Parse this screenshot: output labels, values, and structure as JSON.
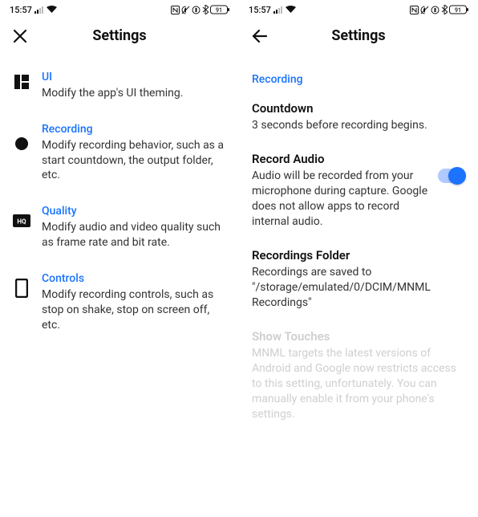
{
  "status": {
    "time": "15:57",
    "battery": "91"
  },
  "left": {
    "title": "Settings",
    "items": [
      {
        "title": "UI",
        "desc": "Modify the app's UI theming."
      },
      {
        "title": "Recording",
        "desc": "Modify recording behavior, such as a start countdown, the output folder, etc."
      },
      {
        "title": "Quality",
        "desc": "Modify audio and video quality such as frame rate and bit rate."
      },
      {
        "title": "Controls",
        "desc": "Modify recording controls, such as stop on shake, stop on screen off, etc."
      }
    ]
  },
  "right": {
    "title": "Settings",
    "section": "Recording",
    "settings": {
      "countdown": {
        "title": "Countdown",
        "desc": "3 seconds before recording begins."
      },
      "audio": {
        "title": "Record Audio",
        "desc": "Audio will be recorded from your microphone during capture. Google does not allow apps to record internal audio."
      },
      "folder": {
        "title": "Recordings Folder",
        "desc": "Recordings are saved to \"/storage/emulated/0/DCIM/MNML Recordings\""
      },
      "touches": {
        "title": "Show Touches",
        "desc": "MNML targets the latest versions of Android and Google now restricts access to this setting, unfortunately. You can manually enable it from your phone's settings."
      }
    }
  }
}
